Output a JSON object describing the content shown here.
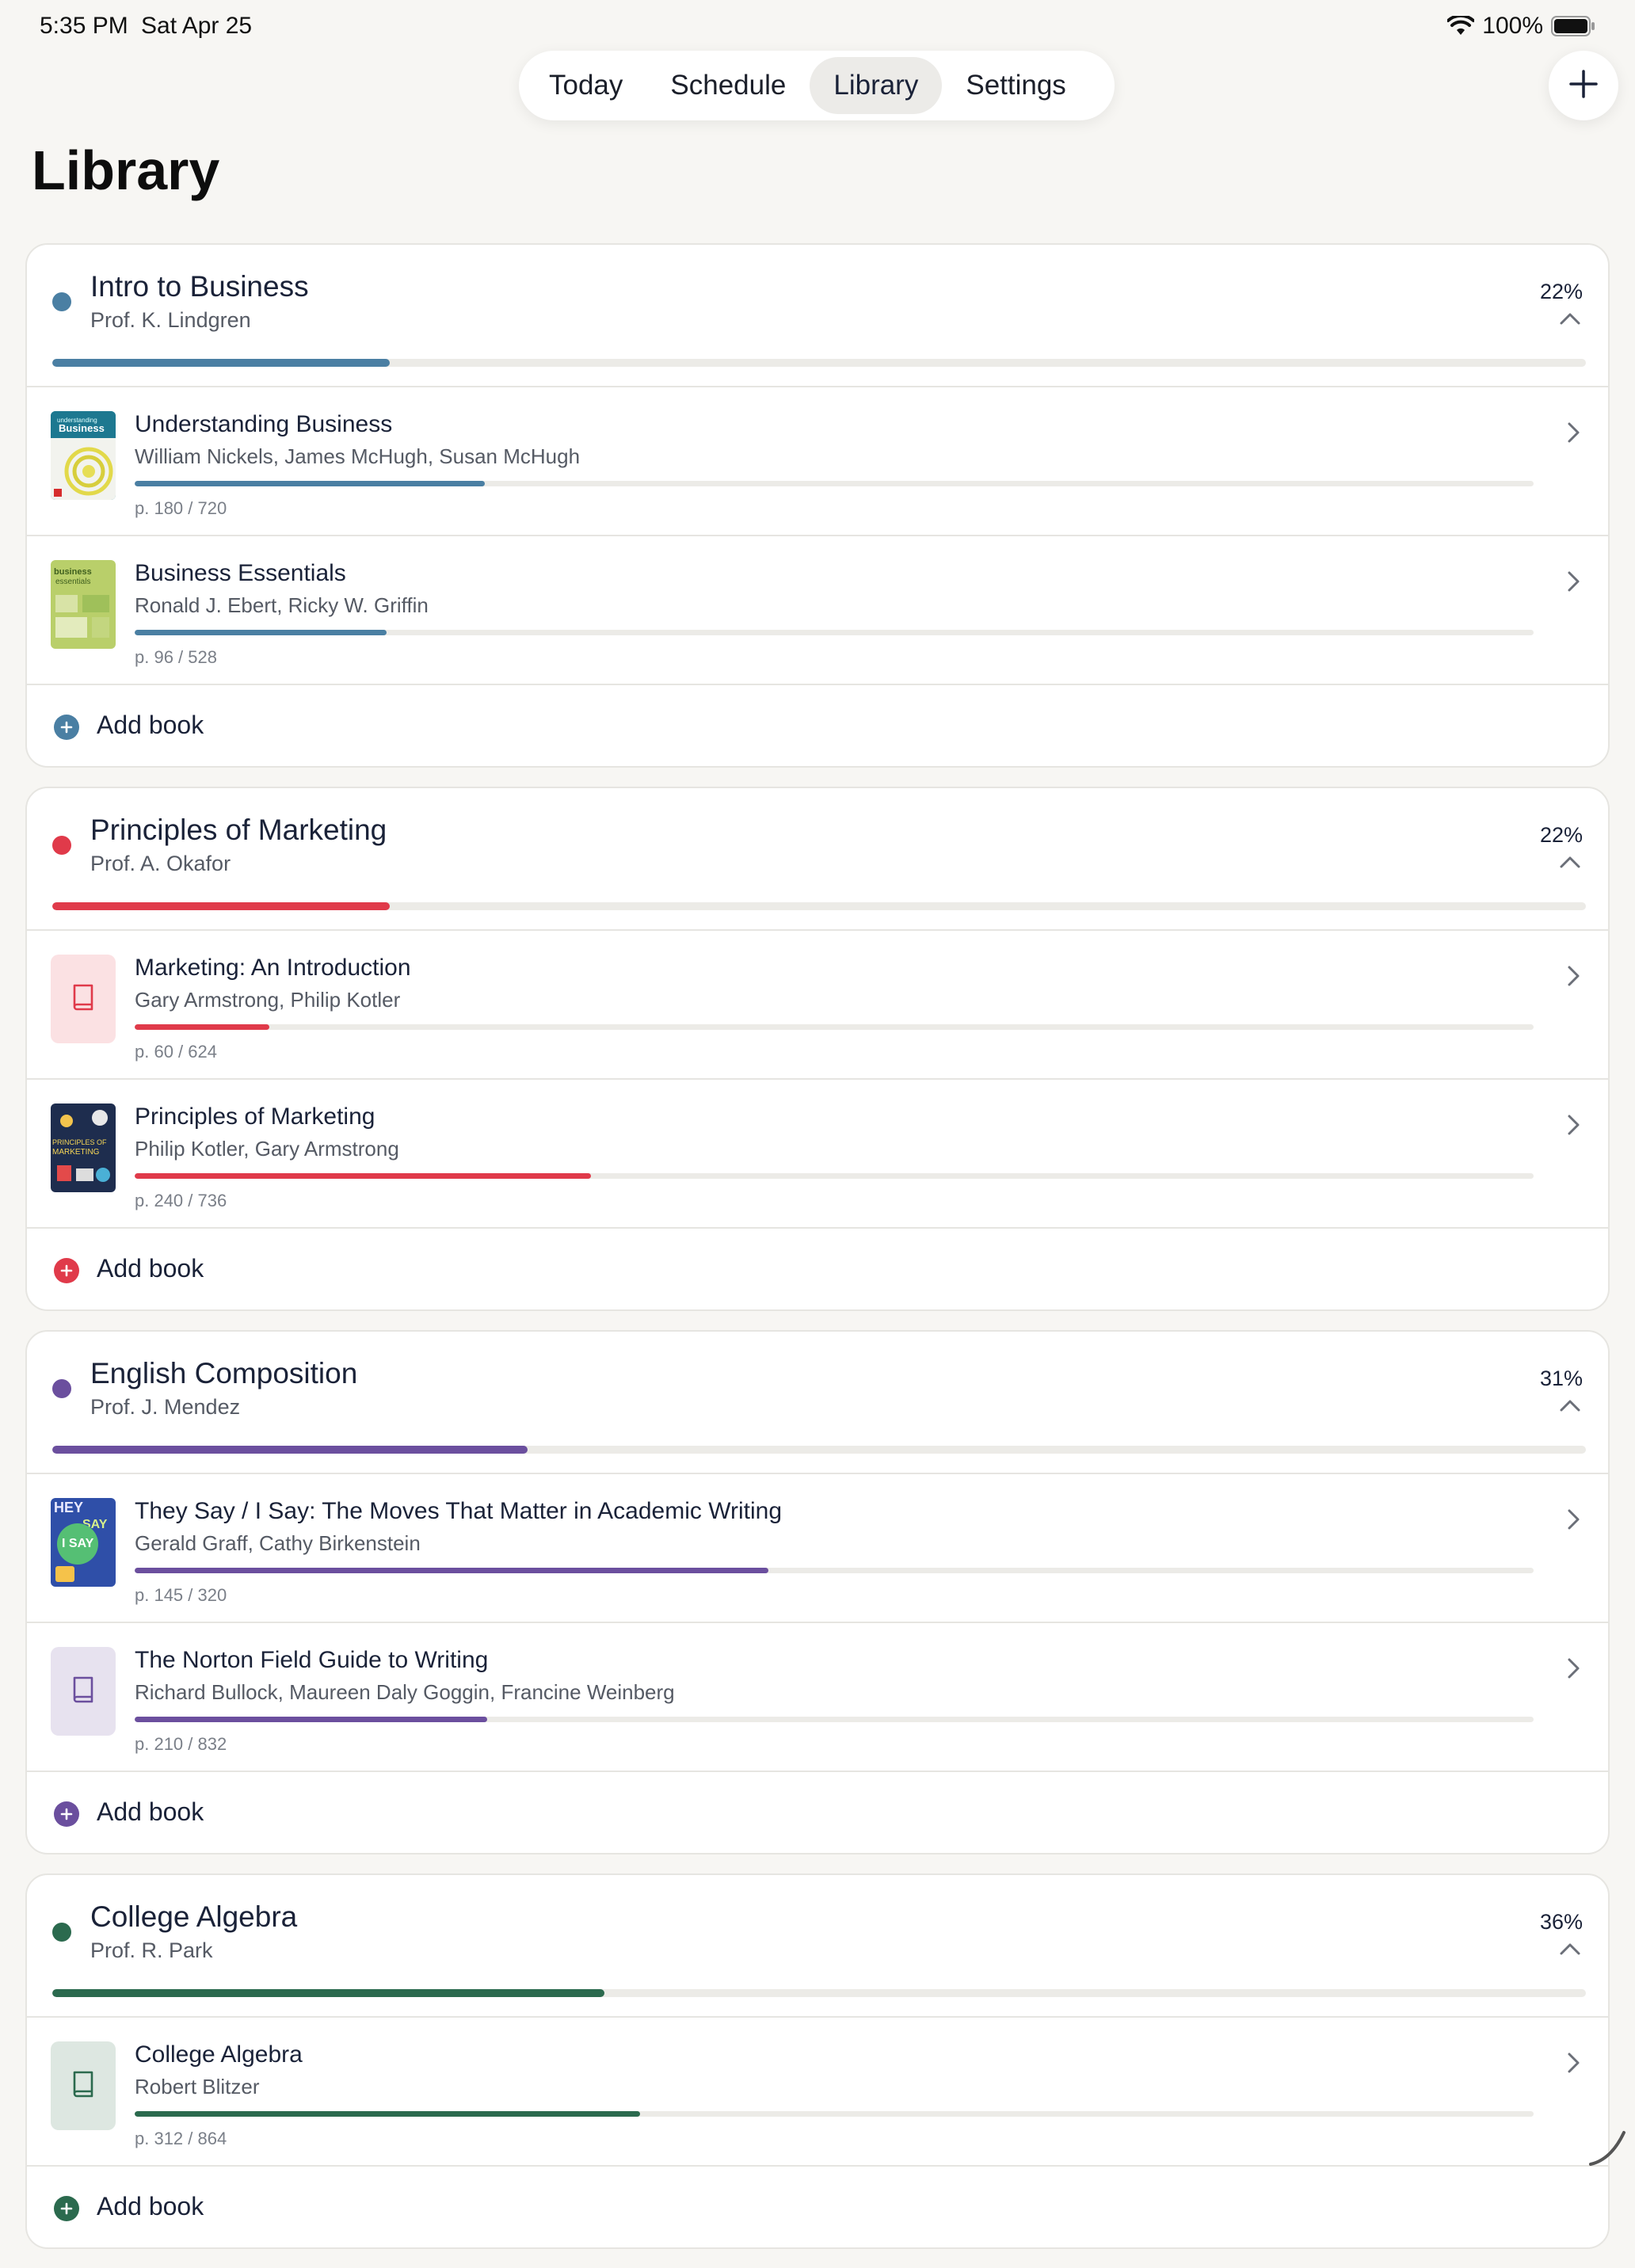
{
  "status": {
    "time": "5:35 PM",
    "date": "Sat Apr 25",
    "battery": "100%"
  },
  "nav": {
    "tabs": [
      {
        "label": "Today"
      },
      {
        "label": "Schedule"
      },
      {
        "label": "Library"
      },
      {
        "label": "Settings"
      }
    ],
    "active_tab": "Library"
  },
  "page_title": "Library",
  "add_book_label": "Add book",
  "courses": [
    {
      "title": "Intro to Business",
      "professor": "Prof. K. Lindgren",
      "percent": "22%",
      "progress": 0.22,
      "color": "#4a7fa3",
      "tint": "#dbe7ef",
      "books": [
        {
          "title": "Understanding Business",
          "authors": "William Nickels, James McHugh, Susan McHugh",
          "pages": "p. 180 / 720",
          "progress": 0.25,
          "cover": "understanding-business"
        },
        {
          "title": "Business Essentials",
          "authors": "Ronald J. Ebert, Ricky W. Griffin",
          "pages": "p. 96 / 528",
          "progress": 0.18,
          "cover": "business-essentials"
        }
      ]
    },
    {
      "title": "Principles of Marketing",
      "professor": "Prof. A. Okafor",
      "percent": "22%",
      "progress": 0.22,
      "color": "#e03a4a",
      "tint": "#fbe1e3",
      "books": [
        {
          "title": "Marketing: An Introduction",
          "authors": "Gary Armstrong, Philip Kotler",
          "pages": "p. 60 / 624",
          "progress": 0.096,
          "cover": "placeholder"
        },
        {
          "title": "Principles of Marketing",
          "authors": "Philip Kotler, Gary Armstrong",
          "pages": "p. 240 / 736",
          "progress": 0.326,
          "cover": "principles-marketing"
        }
      ]
    },
    {
      "title": "English Composition",
      "professor": "Prof. J. Mendez",
      "percent": "31%",
      "progress": 0.31,
      "color": "#6b4f9e",
      "tint": "#e7e2ef",
      "books": [
        {
          "title": "They Say / I Say: The Moves That Matter in Academic Writing",
          "authors": "Gerald Graff, Cathy Birkenstein",
          "pages": "p. 145 / 320",
          "progress": 0.453,
          "cover": "they-say"
        },
        {
          "title": "The Norton Field Guide to Writing",
          "authors": "Richard Bullock, Maureen Daly Goggin, Francine Weinberg",
          "pages": "p. 210 / 832",
          "progress": 0.252,
          "cover": "placeholder"
        }
      ]
    },
    {
      "title": "College Algebra",
      "professor": "Prof. R. Park",
      "percent": "36%",
      "progress": 0.36,
      "color": "#2b6a4e",
      "tint": "#dde7e1",
      "books": [
        {
          "title": "College Algebra",
          "authors": "Robert Blitzer",
          "pages": "p. 312 / 864",
          "progress": 0.361,
          "cover": "placeholder"
        }
      ]
    }
  ]
}
